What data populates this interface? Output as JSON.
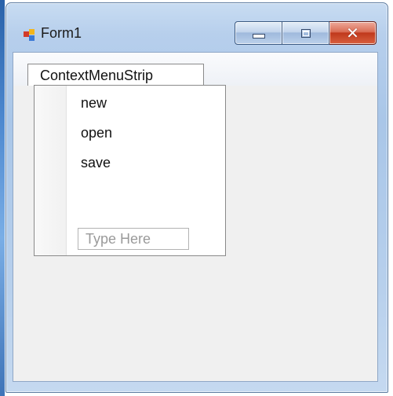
{
  "window": {
    "title": "Form1",
    "icon": "winforms-app-icon",
    "buttons": {
      "minimize": "minimize-icon",
      "maximize": "maximize-icon",
      "close": "close-icon"
    }
  },
  "designer": {
    "menu_tab_label": "ContextMenuStrip",
    "items": [
      "new",
      "open",
      "save"
    ],
    "type_here_placeholder": "Type Here"
  },
  "colors": {
    "close_button": "#c0391c",
    "client_background": "#f0f0f0"
  }
}
